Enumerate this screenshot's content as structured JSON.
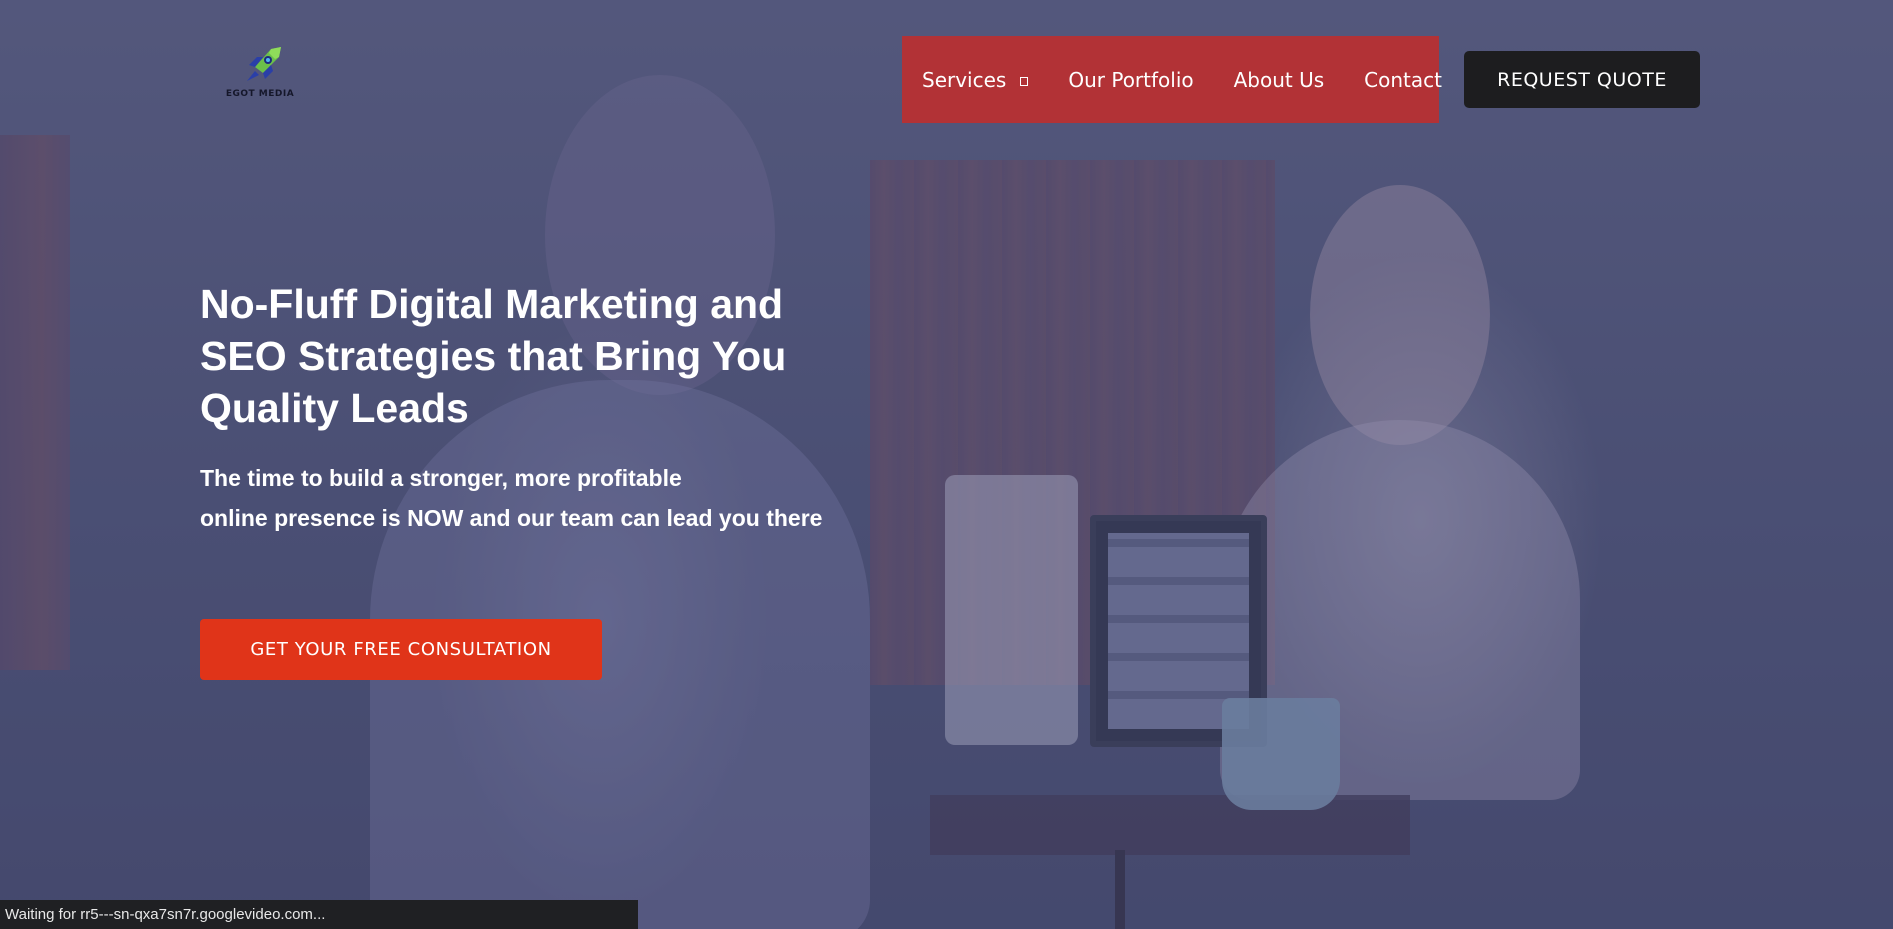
{
  "brand": {
    "name": "EGOT MEDIA"
  },
  "nav": {
    "items": [
      {
        "label": "Services",
        "icon": "chevron-down-icon"
      },
      {
        "label": "Our Portfolio"
      },
      {
        "label": "About Us"
      },
      {
        "label": "Contact"
      }
    ],
    "background_color": "#b23236"
  },
  "header": {
    "request_quote_label": "REQUEST QUOTE"
  },
  "hero": {
    "title": "No-Fluff Digital Marketing and SEO Strategies that Bring You Quality Leads",
    "subtitle_line1": "The time to build a stronger, more profitable",
    "subtitle_line2": "online presence is NOW and our team can lead you there",
    "cta_label": "GET YOUR FREE CONSULTATION",
    "cta_color": "#e03419"
  },
  "status_bar": {
    "text": "Waiting for rr5---sn-qxa7sn7r.googlevideo.com..."
  }
}
